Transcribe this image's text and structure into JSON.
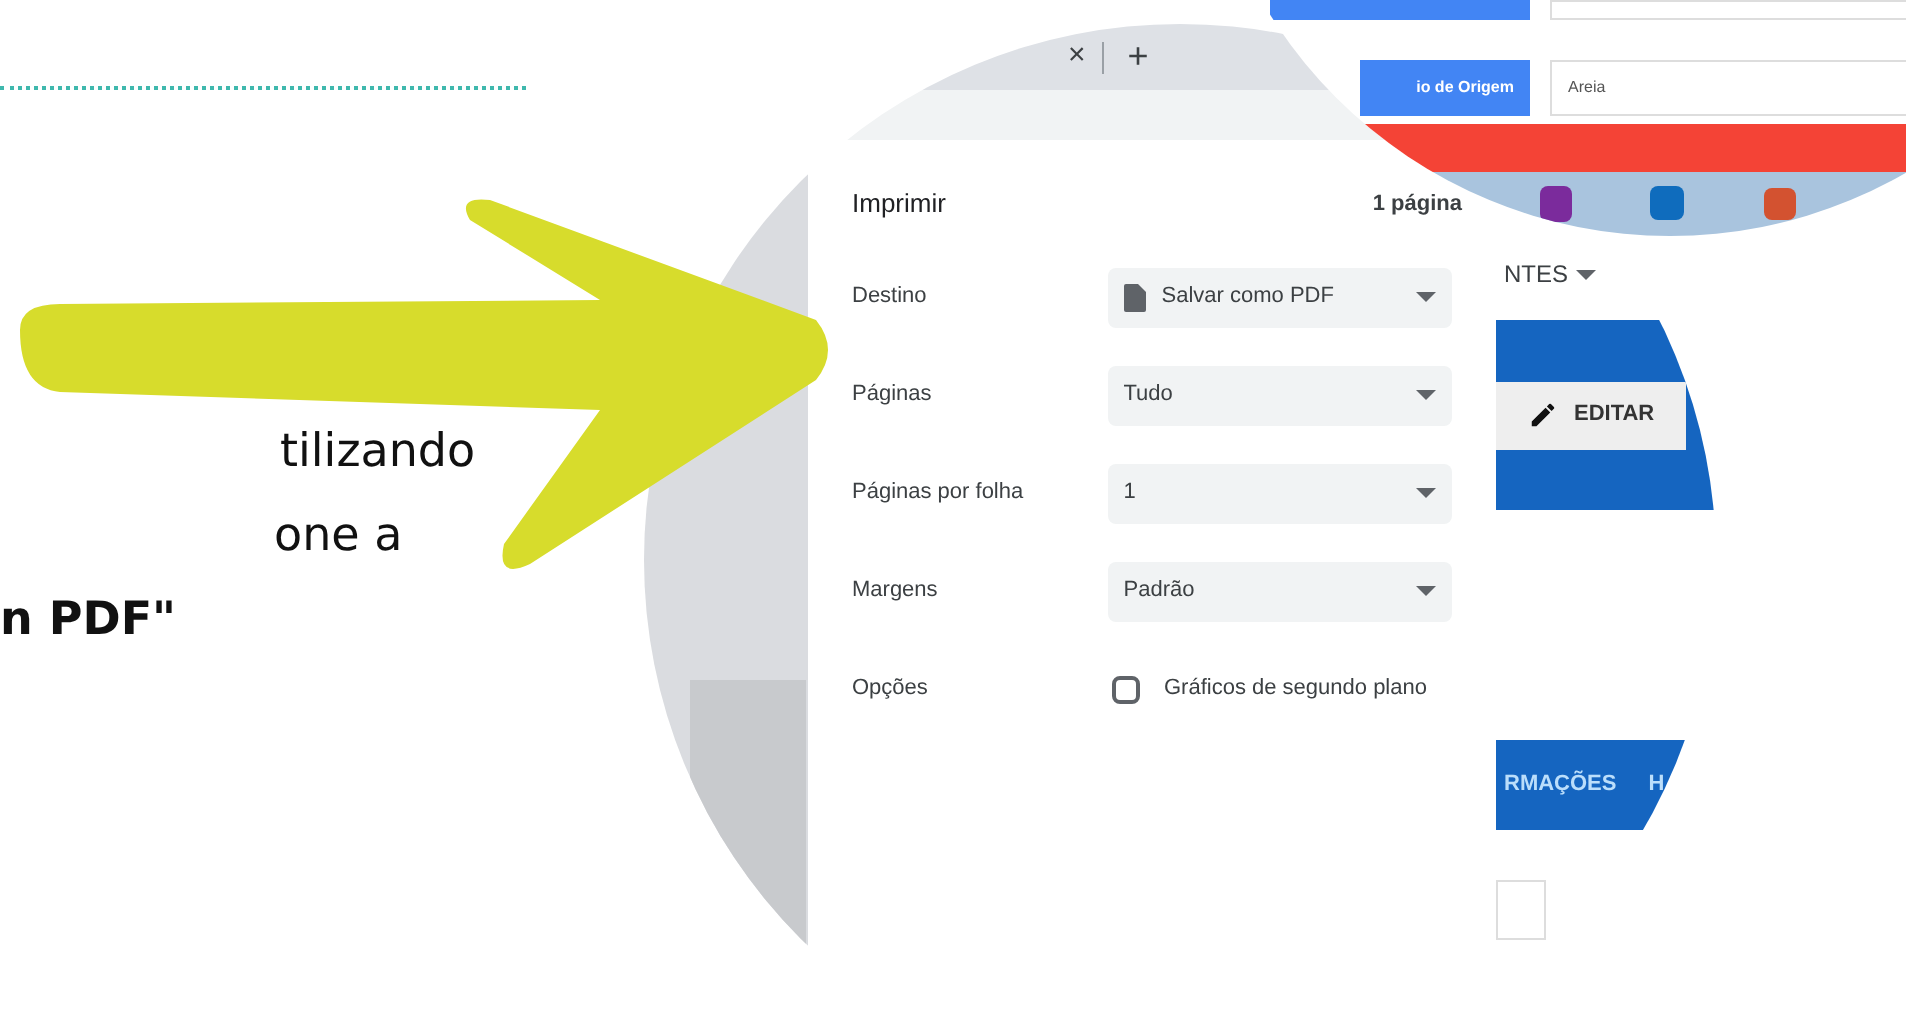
{
  "tutorial_text": [
    {
      "text": "tilizando",
      "bold": false
    },
    {
      "text": "one a",
      "bold": false
    },
    {
      "text": "n PDF\"",
      "bold": true
    }
  ],
  "browser_tabs": {
    "close": "×",
    "new_tab": "+"
  },
  "form_fields": [
    {
      "label": "io de Origem",
      "value": "Areia"
    }
  ],
  "print_dialog": {
    "title": "Imprimir",
    "page_count": "1 página",
    "settings": [
      {
        "label": "Destino",
        "kind": "select",
        "value": "Salvar como PDF",
        "file_icon": true
      },
      {
        "label": "Páginas",
        "kind": "select",
        "value": "Tudo",
        "file_icon": false
      },
      {
        "label": "Páginas por folha",
        "kind": "select",
        "value": "1",
        "file_icon": false
      },
      {
        "label": "Margens",
        "kind": "select",
        "value": "Padrão",
        "file_icon": false
      },
      {
        "label": "Opções",
        "kind": "checkbox",
        "text": "Gráficos de segundo plano",
        "checked": false
      }
    ]
  },
  "background_page": {
    "menu": "NTES",
    "edit_button": "EDITAR",
    "tabs": [
      "RMAÇÕES",
      "H"
    ]
  }
}
